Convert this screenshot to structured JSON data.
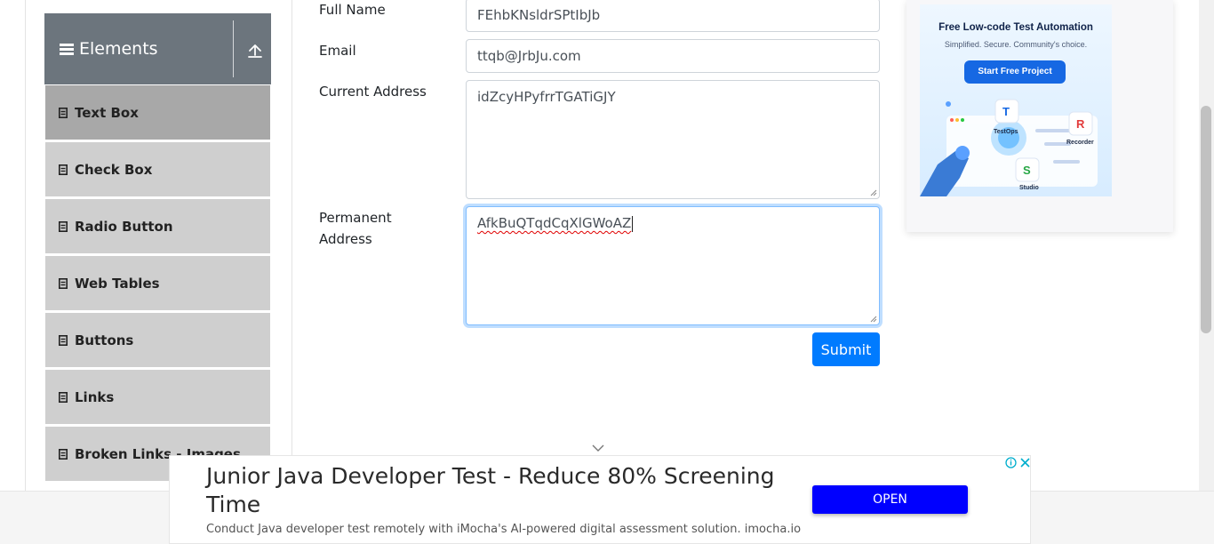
{
  "sidebar": {
    "group_title": "Elements",
    "items": [
      {
        "label": "Text Box"
      },
      {
        "label": "Check Box"
      },
      {
        "label": "Radio Button"
      },
      {
        "label": "Web Tables"
      },
      {
        "label": "Buttons"
      },
      {
        "label": "Links"
      },
      {
        "label": "Broken Links - Images"
      }
    ]
  },
  "form": {
    "full_name_label": "Full Name",
    "full_name_value": "FEhbKNsldrSPtIbJb",
    "email_label": "Email",
    "email_value": "ttqb@JrbJu.com",
    "current_address_label": "Current Address",
    "current_address_value": "idZcyHPyfrrTGATiGJY",
    "permanent_address_label_line1": "Permanent",
    "permanent_address_label_line2": "Address",
    "permanent_address_value": "AfkBuQTqdCqXlGWoAZ",
    "submit_label": "Submit"
  },
  "side_ad": {
    "title": "Free Low-code Test Automation",
    "subtitle": "Simplified. Secure. Community's choice.",
    "button": "Start Free Project",
    "tags": [
      "TestOps",
      "Recorder",
      "Studio"
    ]
  },
  "bottom_ad": {
    "headline": "Junior Java Developer Test - Reduce 80% Screening Time",
    "description": "Conduct Java developer test remotely with iMocha's AI-powered digital assessment solution. imocha.io",
    "button": "OPEN"
  },
  "colors": {
    "primary": "#007bff",
    "sidebar_header": "#6c757d",
    "menu_item": "#cfcfcf",
    "menu_item_active": "#a8a8a8",
    "ad_open_button": "#0000ff"
  },
  "icons": [
    "hamburger-icon",
    "collapse-up-icon",
    "menu-item-icon",
    "resize-handle-icon",
    "chevron-down-icon",
    "adchoices-icon",
    "close-icon"
  ]
}
